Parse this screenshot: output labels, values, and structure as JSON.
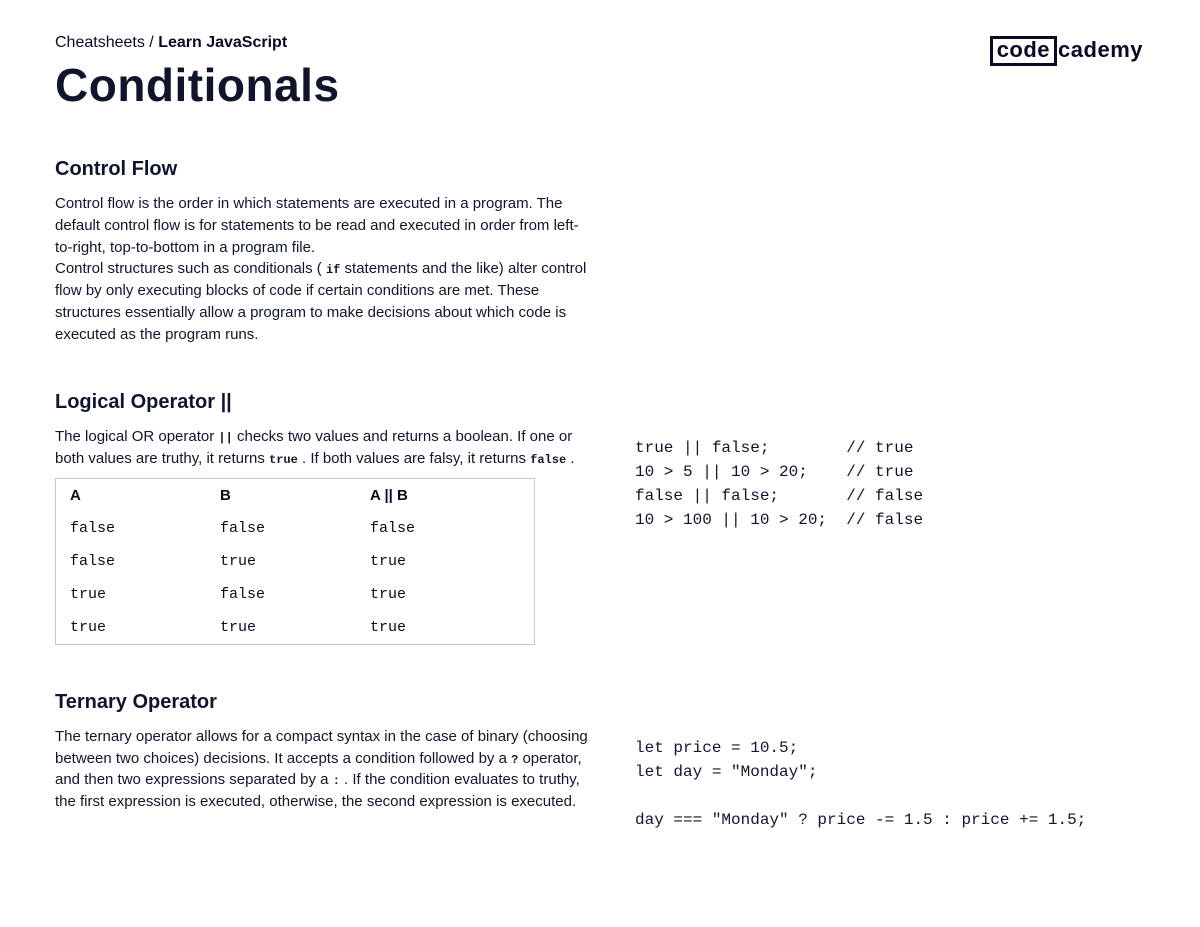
{
  "logo": {
    "boxed": "code",
    "plain": "cademy"
  },
  "breadcrumb": {
    "parent": "Cheatsheets",
    "separator": " / ",
    "current": "Learn JavaScript"
  },
  "title": "Conditionals",
  "section1": {
    "heading": "Control Flow",
    "para1": "Control flow is the order in which statements are executed in a program. The default control flow is for statements to be read and executed in order from left-to-right, top-to-bottom in a program file.",
    "para2a": "Control structures such as conditionals ( ",
    "para2_code": "if",
    "para2b": " statements and the like) alter control flow by only executing blocks of code if certain conditions are met. These structures essentially allow a program to make decisions about which code is executed as the program runs."
  },
  "section2": {
    "heading": "Logical Operator ||",
    "body_a": "The logical OR operator ",
    "body_code1": "||",
    "body_b": " checks two values and returns a boolean. If one or both values are truthy, it returns ",
    "body_code2": "true",
    "body_c": " . If both values are falsy, it returns ",
    "body_code3": "false",
    "body_d": " .",
    "table": {
      "header": [
        "A",
        "B",
        "A || B"
      ],
      "rows": [
        [
          "false",
          "false",
          "false"
        ],
        [
          "false",
          "true",
          "true"
        ],
        [
          "true",
          "false",
          "true"
        ],
        [
          "true",
          "true",
          "true"
        ]
      ]
    },
    "code": "true || false;        // true\n10 > 5 || 10 > 20;    // true\nfalse || false;       // false\n10 > 100 || 10 > 20;  // false"
  },
  "section3": {
    "heading": "Ternary Operator",
    "body_a": "The ternary operator allows for a compact syntax in the case of binary (choosing between two choices) decisions. It accepts a condition followed by a ",
    "body_code1": "?",
    "body_b": " operator, and then two expressions separated by a ",
    "body_code2": ":",
    "body_c": " . If the condition evaluates to truthy, the first expression is executed, otherwise, the second expression is executed.",
    "code": "let price = 10.5;\nlet day = \"Monday\";\n\nday === \"Monday\" ? price -= 1.5 : price += 1.5;"
  }
}
